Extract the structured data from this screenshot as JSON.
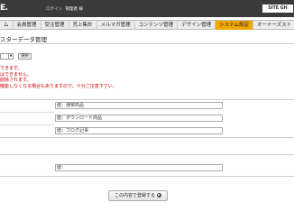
{
  "header": {
    "logo": "E.",
    "login_label": "ログイン",
    "login_user": "管理者 様",
    "brand": "SITE GH"
  },
  "nav": {
    "items": [
      {
        "label": "ム"
      },
      {
        "label": "会員管理"
      },
      {
        "label": "受注管理"
      },
      {
        "label": "売上集計"
      },
      {
        "label": "メルマガ管理"
      },
      {
        "label": "コンテンツ管理"
      },
      {
        "label": "デザイン管理"
      },
      {
        "label": "システム設定"
      },
      {
        "label": "オーナーズスト"
      }
    ],
    "active_index": 7
  },
  "page": {
    "title": "スターデータ管理"
  },
  "controls": {
    "select_button": "選択"
  },
  "notes": [
    "できます。",
    "はできません。",
    "削除されます。",
    "機能しなくなる場合もありますので、十分ご注意下さい。"
  ],
  "fields_group1": [
    {
      "value": "値：通常商品"
    },
    {
      "value": "値：ダウンロード商品"
    },
    {
      "value": "値：ブログ記事"
    }
  ],
  "fields_group2": [
    {
      "value": "値："
    }
  ],
  "submit": {
    "label": "この内容で登録する"
  }
}
